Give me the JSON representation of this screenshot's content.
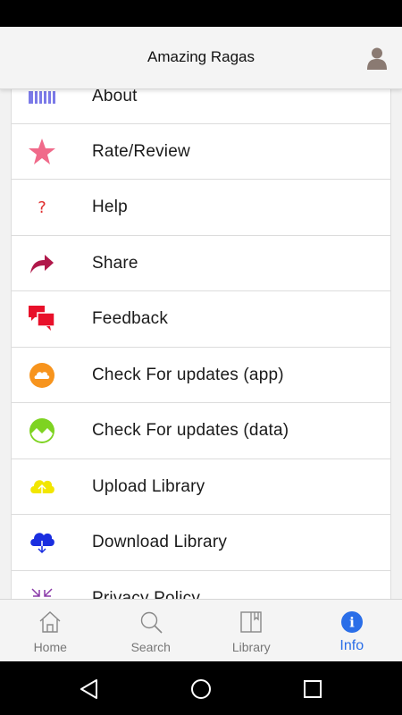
{
  "header": {
    "title": "Amazing Ragas"
  },
  "menu": [
    {
      "label": "About",
      "icon": "about-icon"
    },
    {
      "label": "Rate/Review",
      "icon": "star-icon"
    },
    {
      "label": "Help",
      "icon": "help-icon"
    },
    {
      "label": "Share",
      "icon": "share-icon"
    },
    {
      "label": "Feedback",
      "icon": "feedback-icon"
    },
    {
      "label": "Check For updates (app)",
      "icon": "cloud-update-icon"
    },
    {
      "label": "Check For updates (data)",
      "icon": "landscape-update-icon"
    },
    {
      "label": "Upload Library",
      "icon": "cloud-upload-icon"
    },
    {
      "label": "Download Library",
      "icon": "cloud-download-icon"
    },
    {
      "label": "Privacy Policy",
      "icon": "privacy-icon"
    }
  ],
  "tabs": [
    {
      "label": "Home",
      "icon": "home-icon"
    },
    {
      "label": "Search",
      "icon": "search-icon"
    },
    {
      "label": "Library",
      "icon": "library-icon"
    },
    {
      "label": "Info",
      "icon": "info-icon",
      "active": true
    }
  ],
  "colors": {
    "accent": "#2a6ee8",
    "star": "#f06a8a",
    "feedback": "#e8102a",
    "share": "#b0184a",
    "update_app": "#f7941d",
    "update_data": "#7ed321",
    "upload": "#f2e600",
    "download": "#1a2ee0"
  }
}
